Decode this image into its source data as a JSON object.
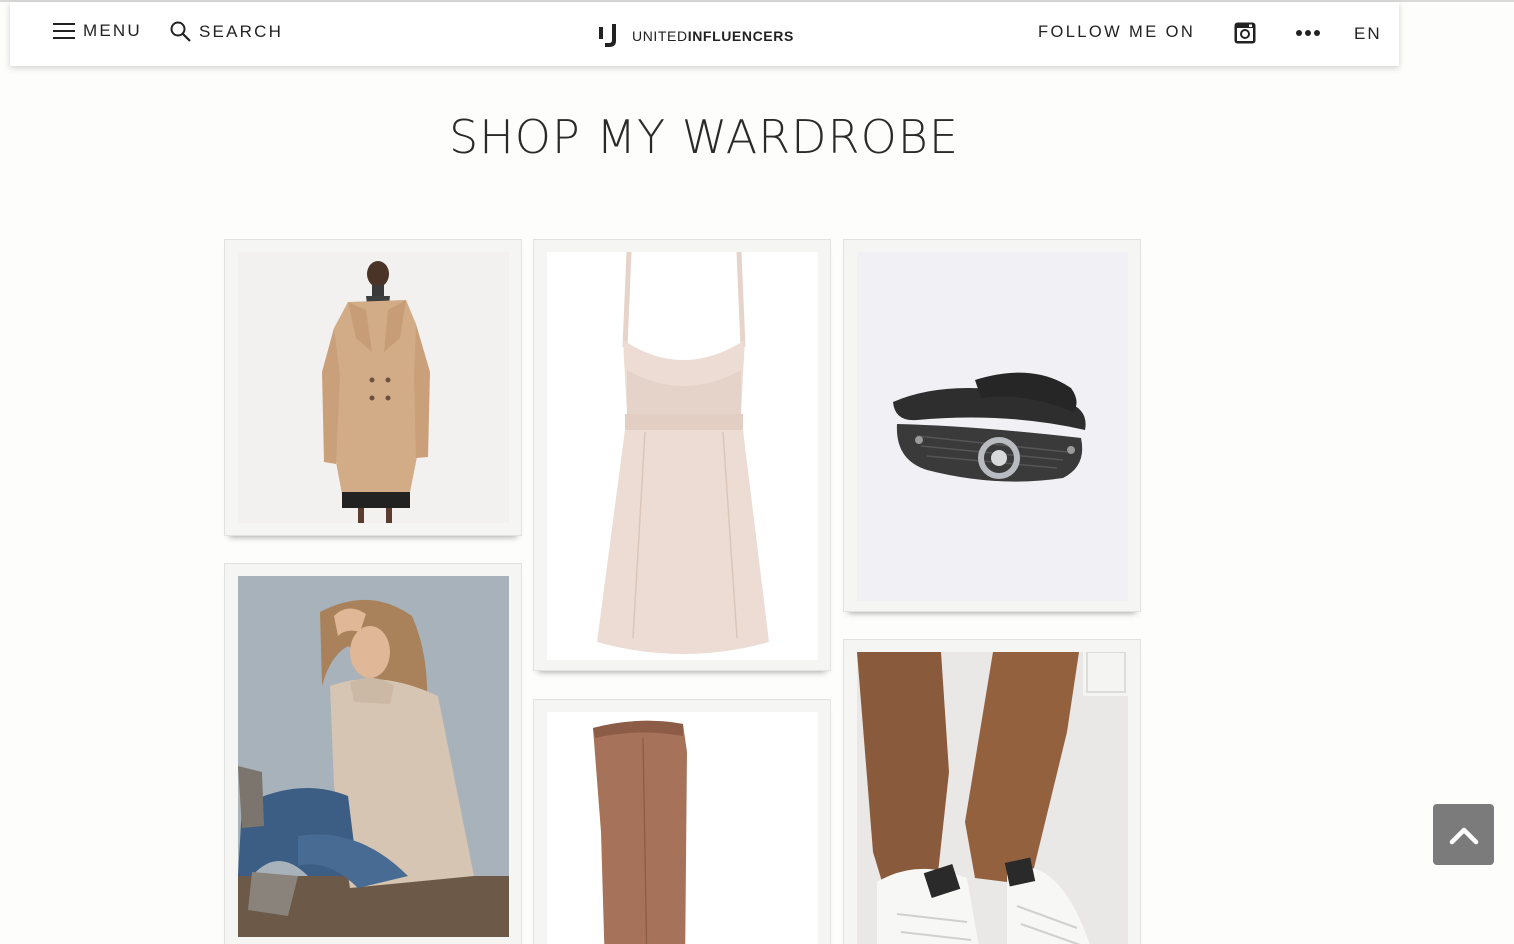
{
  "header": {
    "menu_label": "MENU",
    "search_label": "SEARCH",
    "logo_light": "UNITED",
    "logo_bold": "INFLUENCERS",
    "follow_label": "FOLLOW ME ON",
    "language": "EN"
  },
  "page": {
    "title": "SHOP MY WARDROBE"
  },
  "products": [
    {
      "name": "camel coat",
      "image_bg": "#f2f1ef"
    },
    {
      "name": "nude slip dress",
      "image_bg": "#ffffff"
    },
    {
      "name": "leather wrap bracelet",
      "image_bg": "#f1f0f4"
    },
    {
      "name": "oatmeal turtleneck sweater",
      "image_bg": "#a7b1ba"
    },
    {
      "name": "tan knee-high boots",
      "image_bg": "#ffffff"
    },
    {
      "name": "white sneakers",
      "image_bg": "#ececea"
    }
  ],
  "icons": [
    "hamburger-icon",
    "search-icon",
    "logo-icon",
    "instagram-icon",
    "more-dots-icon",
    "chevron-up-icon"
  ]
}
